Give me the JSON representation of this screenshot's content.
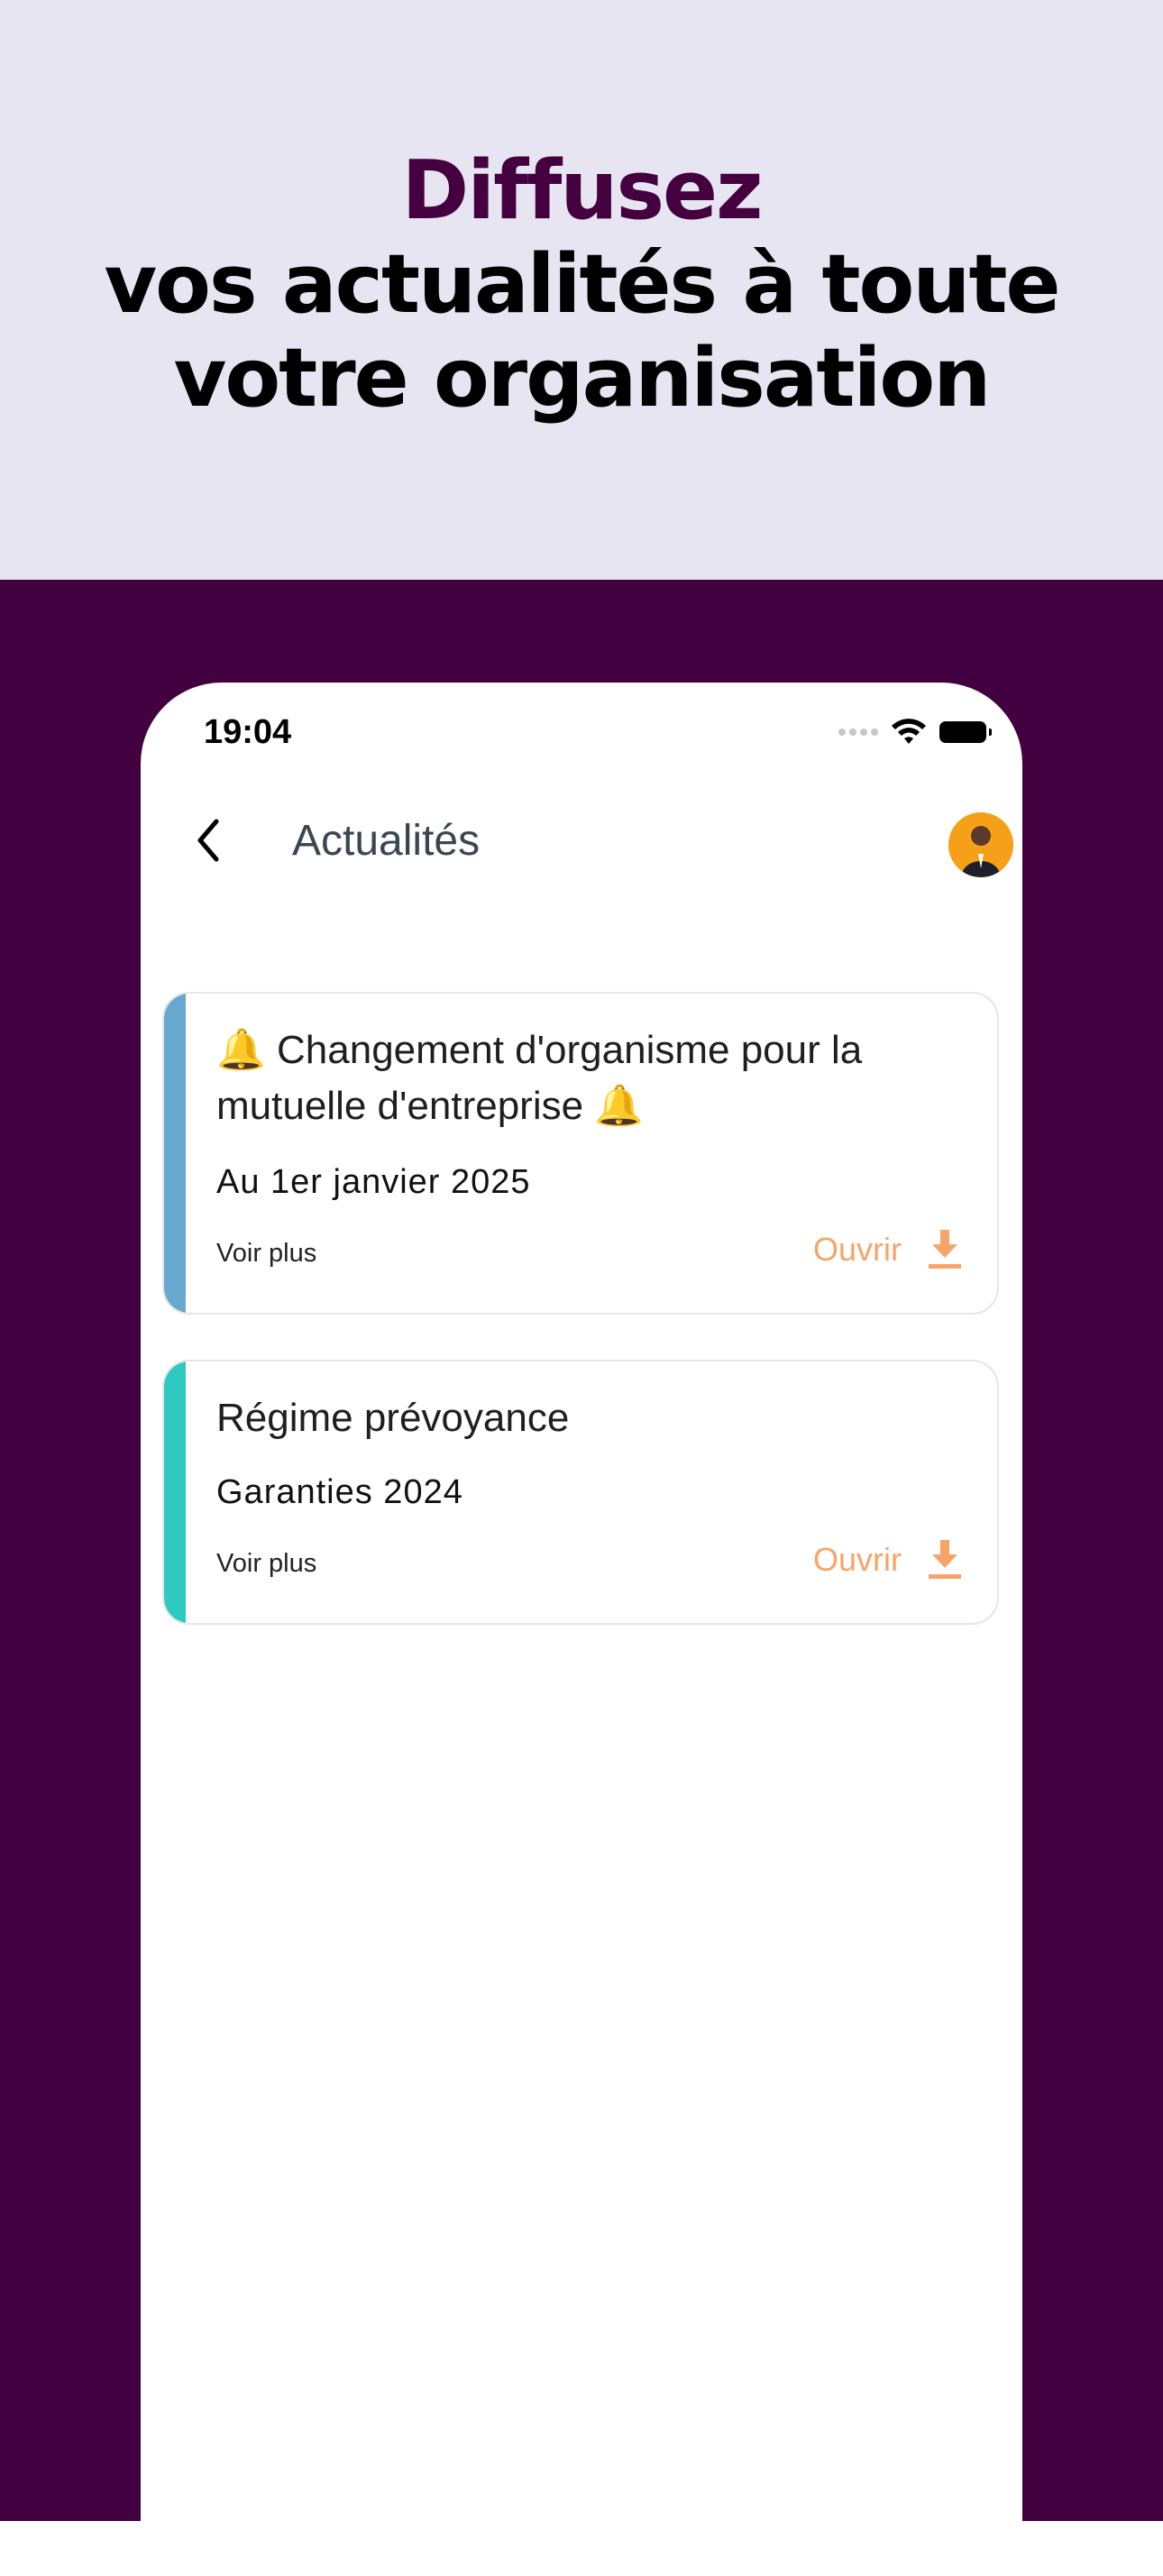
{
  "hero": {
    "line1": "Diffusez",
    "line2": "vos actualités à toute",
    "line3": "votre organisation"
  },
  "status_bar": {
    "time": "19:04",
    "icons": [
      "signal-dots-icon",
      "wifi-icon",
      "battery-icon"
    ]
  },
  "header": {
    "title": "Actualités",
    "back_icon": "chevron-left-icon",
    "avatar": "user-avatar"
  },
  "news": [
    {
      "title": "🔔 Changement d'organisme pour la mutuelle d'entreprise 🔔",
      "subtitle": "Au 1er janvier 2025",
      "more_label": "Voir plus",
      "open_label": "Ouvrir",
      "accent_color": "#67a9cf",
      "icon": "download-icon"
    },
    {
      "title": "Régime prévoyance",
      "subtitle": "Garanties 2024",
      "more_label": "Voir plus",
      "open_label": "Ouvrir",
      "accent_color": "#2ecac1",
      "icon": "download-icon"
    }
  ],
  "colors": {
    "hero_bg": "#e7e5f1",
    "brand_purple": "#44003f",
    "open_orange": "#f7a468"
  }
}
